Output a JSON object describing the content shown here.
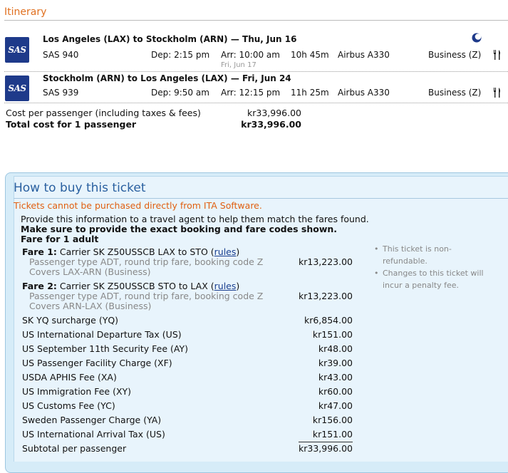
{
  "itinerary": {
    "title": "Itinerary",
    "segments": [
      {
        "airline_logo": "SAS",
        "route": "Los Angeles (LAX) to Stockholm (ARN) — Thu, Jun 16",
        "flight": "SAS 940",
        "dep": "Dep: 2:15 pm",
        "arr": "Arr: 10:00 am",
        "arr_date": "Fri, Jun 17",
        "duration": "10h 45m",
        "aircraft": "Airbus A330",
        "cabin": "Business (Z)",
        "icons": [
          "moon-icon",
          "meal-icon"
        ]
      },
      {
        "airline_logo": "SAS",
        "route": "Stockholm (ARN) to Los Angeles (LAX) — Fri, Jun 24",
        "flight": "SAS 939",
        "dep": "Dep: 9:50 am",
        "arr": "Arr: 12:15 pm",
        "duration": "11h 25m",
        "aircraft": "Airbus A330",
        "cabin": "Business (Z)",
        "icons": [
          "meal-icon"
        ]
      }
    ],
    "cost_per_passenger_label": "Cost per passenger (including taxes & fees)",
    "cost_per_passenger": "kr33,996.00",
    "total_label": "Total cost for 1 passenger",
    "total": "kr33,996.00"
  },
  "howto": {
    "title": "How to buy this ticket",
    "warning": "Tickets cannot be purchased directly from ITA Software.",
    "intro": "Provide this information to a travel agent to help them match the fares found.",
    "instruction": "Make sure to provide the exact booking and fare codes shown.",
    "fare_for": "Fare for 1 adult",
    "fares": [
      {
        "label": "Fare 1:",
        "desc": "Carrier SK Z50USSCB LAX to STO (",
        "rules_link": "rules",
        "close": ")",
        "line2": "Passenger type ADT, round trip fare, booking code Z",
        "line3": "Covers LAX-ARN (Business)",
        "amount": "kr13,223.00"
      },
      {
        "label": "Fare 2:",
        "desc": "Carrier SK Z50USSCB STO to LAX (",
        "rules_link": "rules",
        "close": ")",
        "line2": "Passenger type ADT, round trip fare, booking code Z",
        "line3": "Covers ARN-LAX (Business)",
        "amount": "kr13,223.00"
      }
    ],
    "taxes": [
      {
        "name": "SK YQ surcharge (YQ)",
        "amount": "kr6,854.00"
      },
      {
        "name": "US International Departure Tax (US)",
        "amount": "kr151.00"
      },
      {
        "name": "US September 11th Security Fee (AY)",
        "amount": "kr48.00"
      },
      {
        "name": "US Passenger Facility Charge (XF)",
        "amount": "kr39.00"
      },
      {
        "name": "USDA APHIS Fee (XA)",
        "amount": "kr43.00"
      },
      {
        "name": "US Immigration Fee (XY)",
        "amount": "kr60.00"
      },
      {
        "name": "US Customs Fee (YC)",
        "amount": "kr47.00"
      },
      {
        "name": "Sweden Passenger Charge (YA)",
        "amount": "kr156.00"
      },
      {
        "name": "US International Arrival Tax (US)",
        "amount": "kr151.00"
      }
    ],
    "subtotal_label": "Subtotal per passenger",
    "subtotal": "kr33,996.00",
    "notes": [
      {
        "l1": "This ticket is non-",
        "l2": "refundable."
      },
      {
        "l1": "Changes to this ticket will",
        "l2": "incur a penalty fee."
      }
    ]
  }
}
